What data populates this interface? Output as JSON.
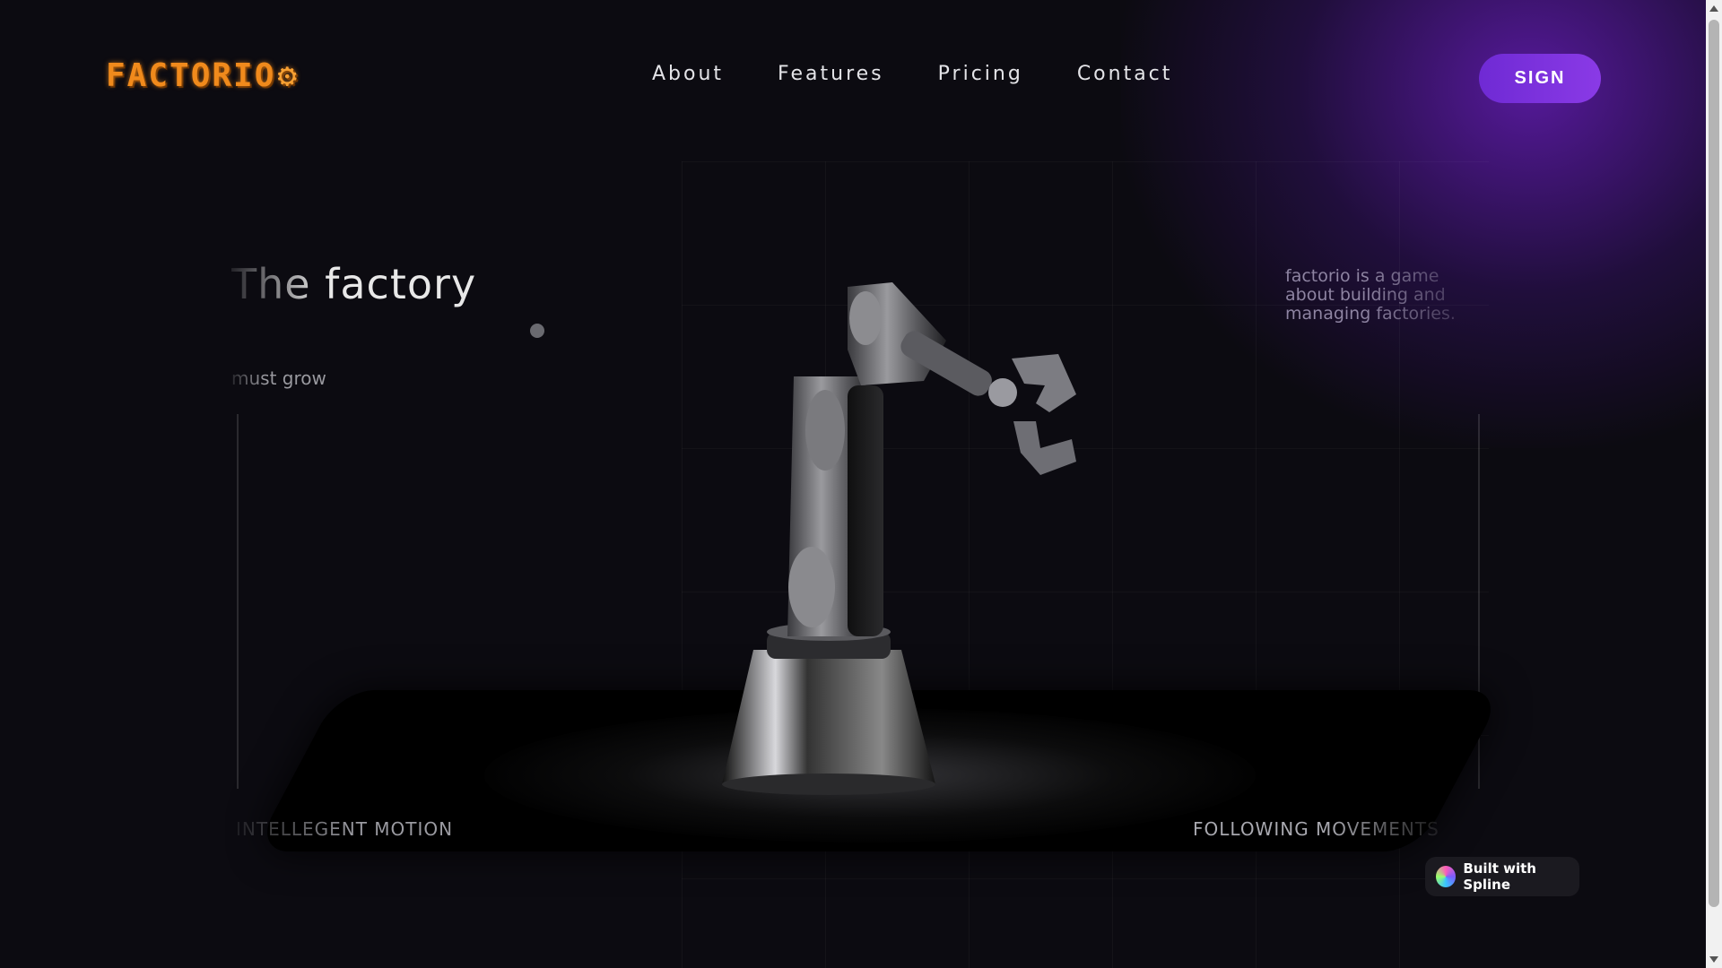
{
  "header": {
    "logo_text": "FACTORIO",
    "nav": [
      {
        "label": "About"
      },
      {
        "label": "Features"
      },
      {
        "label": "Pricing"
      },
      {
        "label": "Contact"
      }
    ],
    "sign_label": "SIGN"
  },
  "hero": {
    "title": "The factory",
    "subtitle": "must grow",
    "description": "factorio is a game about building and managing factories.",
    "label_left": "INTELLEGENT MOTION",
    "label_right": "FOLLOWING MOVEMENTS"
  },
  "badge": {
    "label": "Built with Spline"
  },
  "colors": {
    "accent_purple": "#7b32dc",
    "logo_orange": "#f08a1c",
    "background": "#0c0b11"
  }
}
